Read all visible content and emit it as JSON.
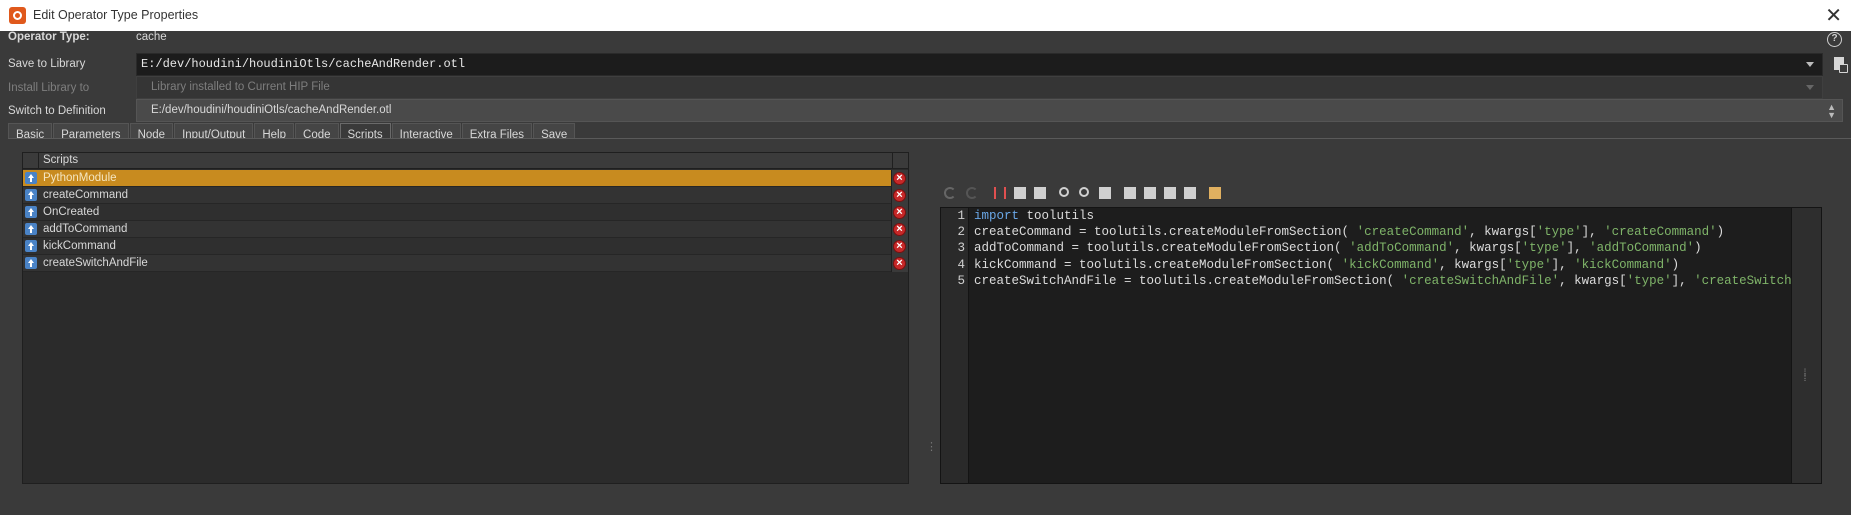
{
  "window": {
    "title": "Edit Operator Type Properties",
    "close_glyph": "✕"
  },
  "operator_type": {
    "label": "Operator Type:",
    "value": "cache"
  },
  "save_to_library": {
    "label": "Save to Library",
    "value": "E:/dev/houdini/houdiniOtls/cacheAndRender.otl"
  },
  "install_library": {
    "label": "Install Library to",
    "value": "Library installed to Current HIP File"
  },
  "switch_definition": {
    "label": "Switch to Definition",
    "value": "E:/dev/houdini/houdiniOtls/cacheAndRender.otl"
  },
  "tabs": [
    {
      "label": "Basic"
    },
    {
      "label": "Parameters"
    },
    {
      "label": "Node"
    },
    {
      "label": "Input/Output"
    },
    {
      "label": "Help"
    },
    {
      "label": "Code"
    },
    {
      "label": "Scripts",
      "active": true
    },
    {
      "label": "Interactive"
    },
    {
      "label": "Extra Files"
    },
    {
      "label": "Save"
    }
  ],
  "scripts_list": {
    "header": "Scripts",
    "items": [
      {
        "name": "PythonModule",
        "selected": true
      },
      {
        "name": "createCommand"
      },
      {
        "name": "OnCreated"
      },
      {
        "name": "addToCommand"
      },
      {
        "name": "kickCommand"
      },
      {
        "name": "createSwitchAndFile"
      }
    ]
  },
  "editor": {
    "toolbar_icons": [
      "undo-icon",
      "redo-icon",
      "cut-icon",
      "copy-icon",
      "paste-icon",
      "find-icon",
      "find-replace-icon",
      "indent-icon",
      "import-icon",
      "export-icon",
      "comment-icon",
      "uncomment-icon",
      "edit-icon"
    ],
    "lines": [
      [
        {
          "t": "import",
          "c": "kw"
        },
        {
          "t": " toolutils",
          "c": ""
        }
      ],
      [
        {
          "t": "createCommand = toolutils.createModuleFromSection( ",
          "c": ""
        },
        {
          "t": "'createCommand'",
          "c": "str"
        },
        {
          "t": ", kwargs[",
          "c": ""
        },
        {
          "t": "'type'",
          "c": "str"
        },
        {
          "t": "], ",
          "c": ""
        },
        {
          "t": "'createCommand'",
          "c": "str"
        },
        {
          "t": ")",
          "c": ""
        }
      ],
      [
        {
          "t": "addToCommand = toolutils.createModuleFromSection( ",
          "c": ""
        },
        {
          "t": "'addToCommand'",
          "c": "str"
        },
        {
          "t": ", kwargs[",
          "c": ""
        },
        {
          "t": "'type'",
          "c": "str"
        },
        {
          "t": "], ",
          "c": ""
        },
        {
          "t": "'addToCommand'",
          "c": "str"
        },
        {
          "t": ")",
          "c": ""
        }
      ],
      [
        {
          "t": "kickCommand = toolutils.createModuleFromSection( ",
          "c": ""
        },
        {
          "t": "'kickCommand'",
          "c": "str"
        },
        {
          "t": ", kwargs[",
          "c": ""
        },
        {
          "t": "'type'",
          "c": "str"
        },
        {
          "t": "], ",
          "c": ""
        },
        {
          "t": "'kickCommand'",
          "c": "str"
        },
        {
          "t": ")",
          "c": ""
        }
      ],
      [
        {
          "t": "createSwitchAndFile = toolutils.createModuleFromSection( ",
          "c": ""
        },
        {
          "t": "'createSwitchAndFile'",
          "c": "str"
        },
        {
          "t": ", kwargs[",
          "c": ""
        },
        {
          "t": "'type'",
          "c": "str"
        },
        {
          "t": "], ",
          "c": ""
        },
        {
          "t": "'createSwitch",
          "c": "str"
        }
      ]
    ]
  },
  "colors": {
    "selection": "#c88b1f",
    "keyword": "#6aa7e6",
    "string": "#7fb469",
    "delete": "#c62828",
    "arrow": "#4a83c6"
  }
}
